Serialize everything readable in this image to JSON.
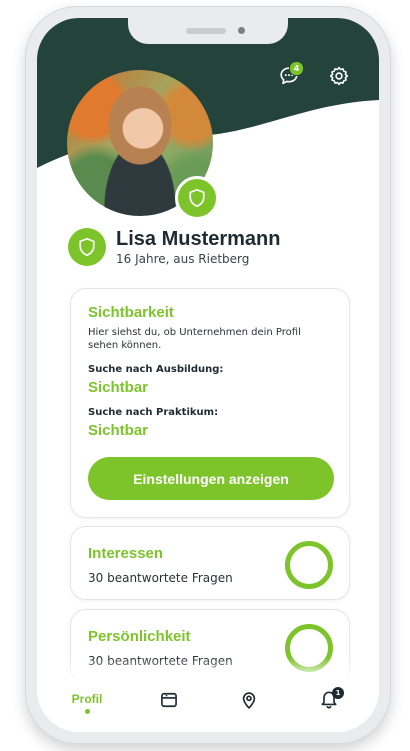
{
  "header": {
    "chat_badge_count": "4",
    "colors": {
      "header_bg": "#24433b",
      "accent": "#7dc42b",
      "text_dark": "#1f2b33"
    },
    "icons": {
      "chat": "chat-icon",
      "settings": "gear-icon"
    }
  },
  "profile": {
    "name": "Lisa Mustermann",
    "details": "16 Jahre, aus Rietberg",
    "verified_icon": "shield-icon"
  },
  "visibility_card": {
    "title": "Sichtbarkeit",
    "description": "Hier siehst du, ob Unternehmen dein Profil sehen können.",
    "training_label": "Suche nach Ausbildung:",
    "training_value": "Sichtbar",
    "internship_label": "Suche nach Praktikum:",
    "internship_value": "Sichtbar",
    "button_label": "Einstellungen anzeigen"
  },
  "interests_card": {
    "title": "Interessen",
    "subtitle": "30 beantwortete Fragen"
  },
  "personality_card": {
    "title": "Persönlichkeit",
    "subtitle": "30 beantwortete Fragen"
  },
  "tabbar": {
    "profile_label": "Profil",
    "notification_badge": "1",
    "icons": {
      "calendar": "calendar-icon",
      "location": "location-pin-icon",
      "notifications": "bell-icon"
    }
  }
}
